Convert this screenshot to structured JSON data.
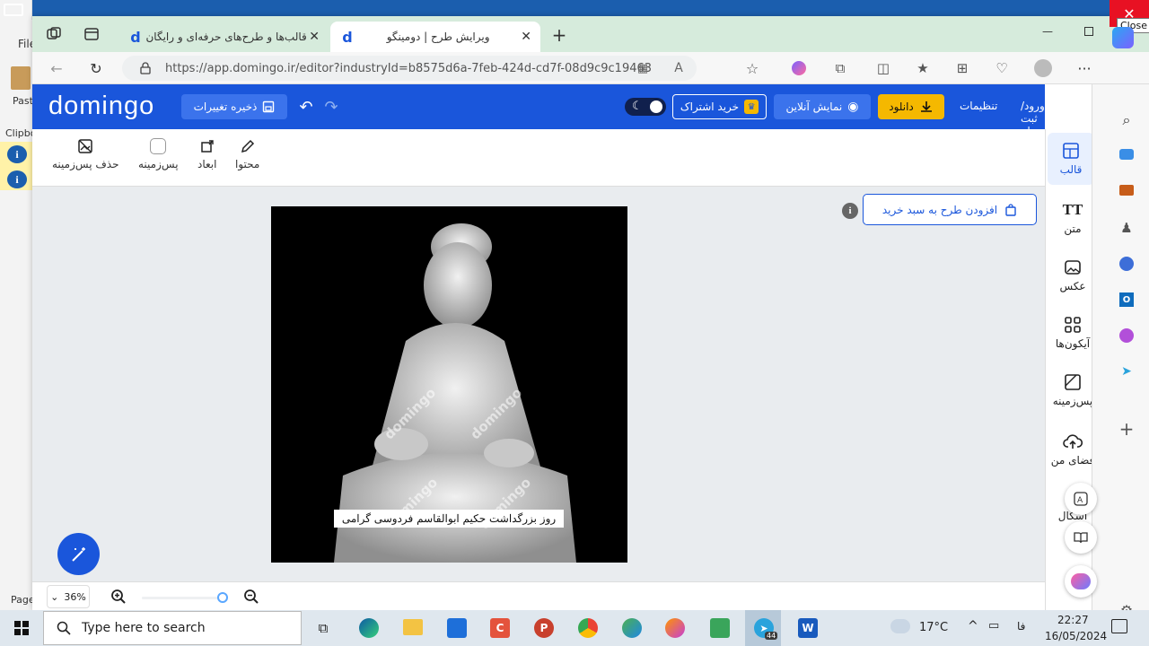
{
  "word": {
    "file_label": "File",
    "paste_label": "Paste",
    "clipboard_label": "Clipbo",
    "page_label": "Page"
  },
  "browser": {
    "tabs": [
      {
        "label": "قالب‌ها و طرح‌های حرفه‌ای و رایگان",
        "active": false
      },
      {
        "label": "ویرایش طرح | دومینگو",
        "active": true
      }
    ],
    "url": "https://app.domingo.ir/editor?industryId=b8575d6a-7feb-424d-cd7f-08d9c9c19463",
    "close_tooltip": "Close"
  },
  "header": {
    "logo": "domingo",
    "save_label": "ذخیره تغییرات",
    "subscribe_label": "خرید اشتراک",
    "preview_label": "نمایش آنلاین",
    "download_label": "دانلود",
    "settings_label": "تنظیمات",
    "login_label": "ورود/ثبت نام"
  },
  "toolbar": {
    "content": "محتوا",
    "dimensions": "ابعاد",
    "background": "پس‌زمینه",
    "remove_bg": "حذف پس‌زمینه"
  },
  "canvas": {
    "add_to_cart": "افزودن طرح به سبد خرید",
    "caption": "روز بزرگداشت حکیم ابوالقاسم فردوسی گرامی",
    "watermark": "domingo"
  },
  "sidebar": [
    {
      "label": "قالب",
      "icon": "template-icon",
      "active": true
    },
    {
      "label": "متن",
      "icon": "text-icon",
      "active": false
    },
    {
      "label": "عکس",
      "icon": "image-icon",
      "active": false
    },
    {
      "label": "آیکون‌ها",
      "icon": "grid-icon",
      "active": false
    },
    {
      "label": "پس‌زمینه",
      "icon": "background-icon",
      "active": false
    },
    {
      "label": "فضای من",
      "icon": "cloud-upload-icon",
      "active": false
    },
    {
      "label": "اشکال",
      "icon": "shapes-icon",
      "active": false
    }
  ],
  "zoom": {
    "value": "36%"
  },
  "taskbar": {
    "search_placeholder": "Type here to search",
    "temperature": "17°C",
    "language": "فا",
    "time": "22:27",
    "date": "16/05/2024",
    "telegram_badge": "44"
  },
  "colors": {
    "brand": "#1a56db",
    "download": "#f5b800",
    "tab_bar": "#d6ebdc"
  }
}
